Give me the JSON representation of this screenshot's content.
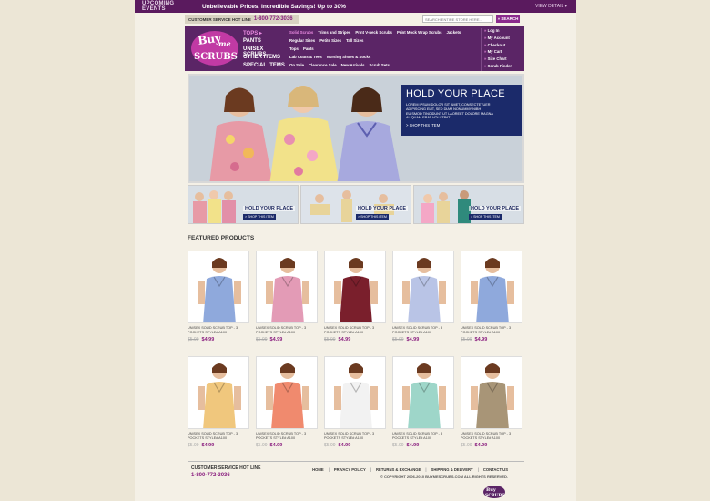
{
  "topbar": {
    "events": "UPCOMING EVENTS",
    "promo": "Unbelievable Prices, Incredible Savings! Up to 30%",
    "view_detail": "VIEW DETAIL ▾"
  },
  "service": {
    "label": "CUSTOMER SERVICE  HOT LINE",
    "phone": "1-800-772-3036"
  },
  "search": {
    "placeholder": "SEARCH ENTIRE STORE HERE...",
    "button": "» SEARCH"
  },
  "logo": {
    "text_top": "Buy",
    "text_mid": "me",
    "text_bottom": "SCRUBS"
  },
  "nav": {
    "categories": [
      "TOPS ▸",
      "PANTS",
      "UNISEX SCRUBS",
      "OTHER ITEMS",
      "SPECIAL ITEMS"
    ],
    "sub_rows": [
      [
        "Solid Scrubs",
        "Trims and Stripes",
        "Print V-neck Scrubs",
        "Print Mock Wrap Scrubs",
        "Jackets"
      ],
      [
        "Regular Sizes",
        "Petite Sizes",
        "Tall Sizes"
      ],
      [
        "Tops",
        "Pants"
      ],
      [
        "Lab Coats & Tees",
        "Nursing Shoes & Socks"
      ],
      [
        "On Sale",
        "Clearance Sale",
        "New Arrivals",
        "Scrub Sets"
      ]
    ],
    "account": [
      "Log In",
      "My Account",
      "Checkout",
      "My Cart",
      "Size Chart",
      "Scrub Finder"
    ]
  },
  "hero": {
    "title": "HOLD YOUR PLACE",
    "body": "LOREM IPSUM DOLOR SIT AMET, CONSECTETUER ADIPISCING ELIT, SED DIAM NONUMMY NIBH EUISMOD TINCIDUNT UT LAOREET DOLORE MAGNA ALIQUAM ERAT VOLUTPAT.",
    "shop": "> SHOP THIS ITEM"
  },
  "thumbs": [
    {
      "caption": "HOLD YOUR PLACE",
      "shop": "> SHOP THIS ITEM"
    },
    {
      "caption": "HOLD YOUR PLACE",
      "shop": "> SHOP THIS ITEM"
    },
    {
      "caption": "HOLD YOUR PLACE",
      "shop": "> SHOP THIS ITEM"
    }
  ],
  "featured": {
    "title": "FEATURED PRODUCTS",
    "products": [
      {
        "name": "UNISEX SOLID SCRUB TOP - 3 POCKETS STYLE# A100",
        "old": "$5.99",
        "new": "$4.99",
        "color": "#8fa9dc"
      },
      {
        "name": "UNISEX SOLID SCRUB TOP - 3 POCKETS STYLE# A100",
        "old": "$5.99",
        "new": "$4.99",
        "color": "#e39bb6"
      },
      {
        "name": "UNISEX SOLID SCRUB TOP - 3 POCKETS STYLE# A100",
        "old": "$5.99",
        "new": "$4.99",
        "color": "#7a1f2c"
      },
      {
        "name": "UNISEX SOLID SCRUB TOP - 3 POCKETS STYLE# A100",
        "old": "$5.99",
        "new": "$4.99",
        "color": "#b9c4e6"
      },
      {
        "name": "UNISEX SOLID SCRUB TOP - 3 POCKETS STYLE# A100",
        "old": "$5.99",
        "new": "$4.99",
        "color": "#8fa9dc"
      },
      {
        "name": "UNISEX SOLID SCRUB TOP - 3 POCKETS STYLE# A100",
        "old": "$5.99",
        "new": "$4.99",
        "color": "#f0c77d"
      },
      {
        "name": "UNISEX SOLID SCRUB TOP - 3 POCKETS STYLE# A100",
        "old": "$5.99",
        "new": "$4.99",
        "color": "#f08a6e"
      },
      {
        "name": "UNISEX SOLID SCRUB TOP - 3 POCKETS STYLE# A100",
        "old": "$5.99",
        "new": "$4.99",
        "color": "#f2f2f2"
      },
      {
        "name": "UNISEX SOLID SCRUB TOP - 3 POCKETS STYLE# A100",
        "old": "$5.99",
        "new": "$4.99",
        "color": "#9ed6c9"
      },
      {
        "name": "UNISEX SOLID SCRUB TOP - 3 POCKETS STYLE# A100",
        "old": "$5.99",
        "new": "$4.99",
        "color": "#a89577"
      }
    ]
  },
  "footer": {
    "service": "CUSTOMER SERVICE  HOT LINE",
    "phone": "1-800-772-3036",
    "links": [
      "HOME",
      "PRIVACY POLICY",
      "RETURNS & EXCHANGE",
      "SHIPPING & DELIVERY",
      "CONTACT US"
    ],
    "copyright": "© COPYRIGHT 2006-2010 BUYMESCRUBS.COM ALL RIGHTS RESERVED."
  },
  "colors": {
    "brand": "#5b2566",
    "accent": "#8a1e7f",
    "hero_box": "#1b2a6a"
  }
}
